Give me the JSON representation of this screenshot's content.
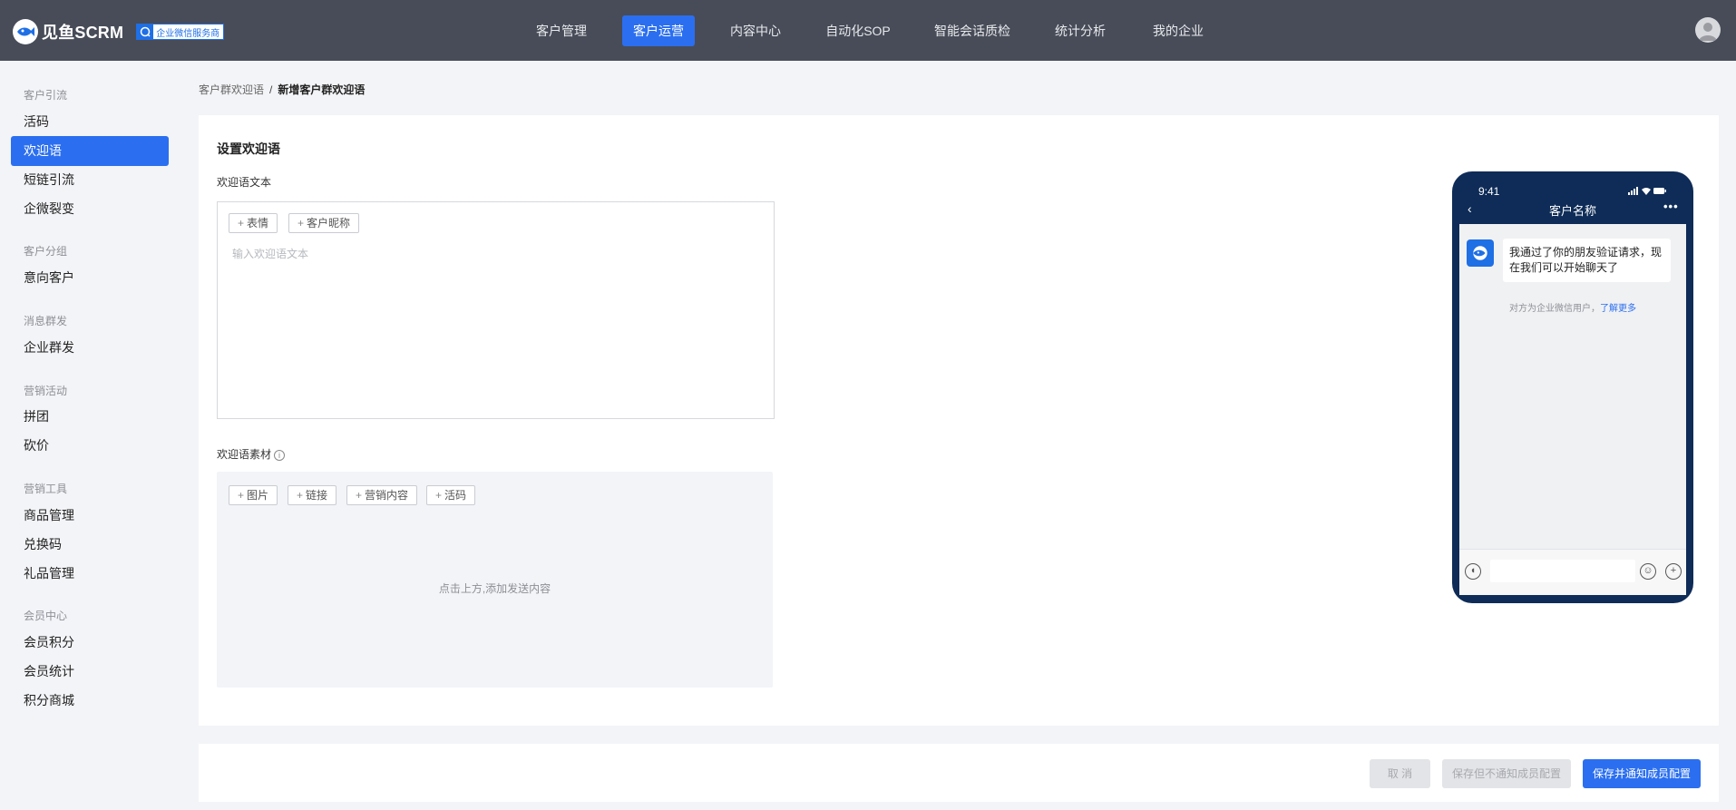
{
  "header": {
    "brand": "见鱼SCRM",
    "badge": "企业微信服务商",
    "nav": [
      {
        "label": "客户管理",
        "active": false
      },
      {
        "label": "客户运营",
        "active": true
      },
      {
        "label": "内容中心",
        "active": false
      },
      {
        "label": "自动化SOP",
        "active": false
      },
      {
        "label": "智能会话质检",
        "active": false
      },
      {
        "label": "统计分析",
        "active": false
      },
      {
        "label": "我的企业",
        "active": false
      }
    ]
  },
  "sidebar": {
    "groups": [
      {
        "title": "客户引流",
        "items": [
          "活码",
          "欢迎语",
          "短链引流",
          "企微裂变"
        ]
      },
      {
        "title": "客户分组",
        "items": [
          "意向客户"
        ]
      },
      {
        "title": "消息群发",
        "items": [
          "企业群发"
        ]
      },
      {
        "title": "营销活动",
        "items": [
          "拼团",
          "砍价"
        ]
      },
      {
        "title": "营销工具",
        "items": [
          "商品管理",
          "兑换码",
          "礼品管理"
        ]
      },
      {
        "title": "会员中心",
        "items": [
          "会员积分",
          "会员统计",
          "积分商城"
        ]
      }
    ],
    "active_item": "欢迎语"
  },
  "breadcrumb": {
    "parent": "客户群欢迎语",
    "separator": "/",
    "current": "新增客户群欢迎语"
  },
  "form": {
    "section_title": "设置欢迎语",
    "text_label": "欢迎语文本",
    "text_chips": [
      "表情",
      "客户昵称"
    ],
    "text_placeholder": "输入欢迎语文本",
    "material_label": "欢迎语素材",
    "material_chips": [
      "图片",
      "链接",
      "营销内容",
      "活码"
    ],
    "material_empty": "点击上方,添加发送内容"
  },
  "preview": {
    "time": "9:41",
    "title": "客户名称",
    "message": "我通过了你的朋友验证请求，现在我们可以开始聊天了",
    "note": "对方为企业微信用户，",
    "note_link": "了解更多"
  },
  "actions": {
    "cancel": "取 消",
    "save_no_notify": "保存但不通知成员配置",
    "save_notify": "保存并通知成员配置"
  },
  "colors": {
    "primary": "#2b6ff0",
    "topbar": "#474c58",
    "phone_frame": "#0e2c57"
  }
}
